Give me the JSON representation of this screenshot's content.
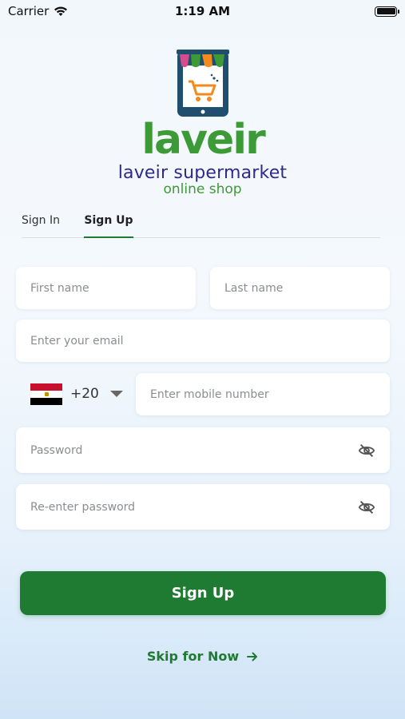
{
  "status_bar": {
    "carrier": "Carrier",
    "time": "1:19 AM"
  },
  "brand": {
    "wordmark": "laveir",
    "name": "laveir supermarket",
    "tagline": "online shop",
    "colors": {
      "green": "#3c9a37",
      "navy": "#2e2a8c",
      "phone": "#1f4e6e"
    }
  },
  "tabs": [
    {
      "label": "Sign In",
      "active": false
    },
    {
      "label": "Sign Up",
      "active": true
    }
  ],
  "form": {
    "first_name": {
      "placeholder": "First name",
      "value": ""
    },
    "last_name": {
      "placeholder": "Last name",
      "value": ""
    },
    "email": {
      "placeholder": "Enter your email",
      "value": ""
    },
    "country": {
      "flag": "egypt-flag",
      "dial_code": "+20"
    },
    "mobile": {
      "placeholder": "Enter mobile number",
      "value": ""
    },
    "password": {
      "placeholder": "Password",
      "value": "",
      "icon": "eye-off-icon"
    },
    "confirm_password": {
      "placeholder": "Re-enter password",
      "value": "",
      "icon": "eye-off-icon"
    }
  },
  "actions": {
    "signup_label": "Sign Up",
    "skip_label": "Skip for Now",
    "accent": "#1f7a32"
  }
}
